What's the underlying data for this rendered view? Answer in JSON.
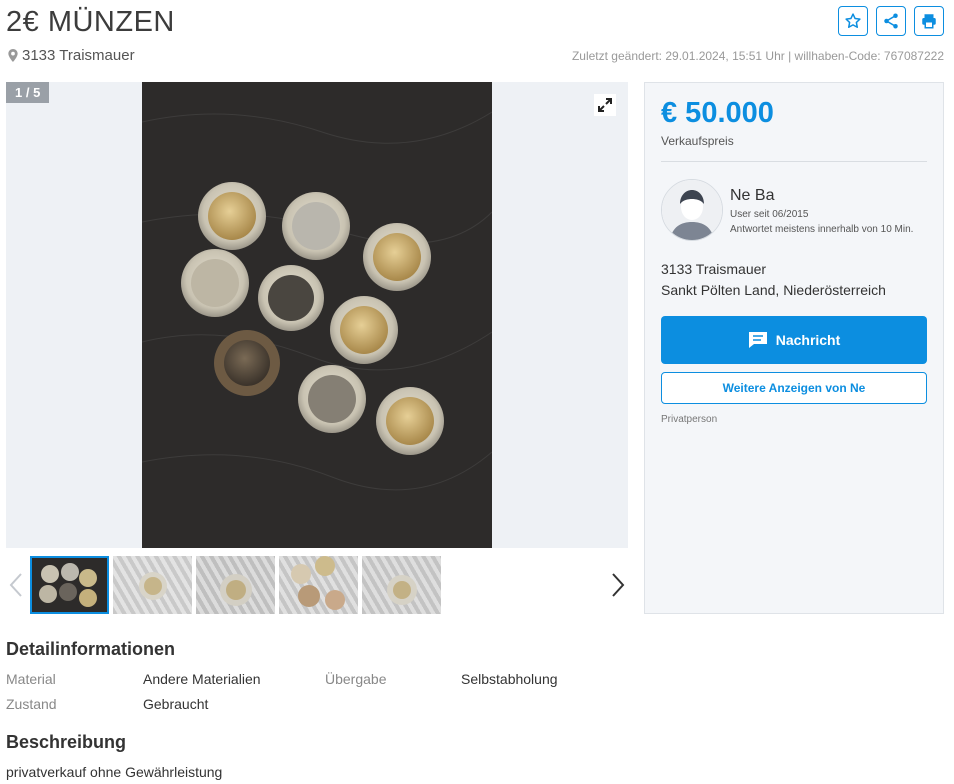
{
  "ad": {
    "title": "2€ MÜNZEN",
    "location": "3133 Traismauer",
    "meta": "Zuletzt geändert: 29.01.2024, 15:51 Uhr | willhaben-Code: 767087222"
  },
  "actions": {
    "favorite_icon": "star-icon",
    "share_icon": "share-icon",
    "print_icon": "print-icon"
  },
  "gallery": {
    "counter": "1 / 5",
    "thumbnails": [
      "thumb-1",
      "thumb-2",
      "thumb-3",
      "thumb-4",
      "thumb-5"
    ]
  },
  "sidebar": {
    "price": "€ 50.000",
    "price_label": "Verkaufspreis",
    "seller_name": "Ne Ba",
    "seller_since": "User seit 06/2015",
    "seller_response": "Antwortet meistens innerhalb von 10 Min.",
    "address_line1": "3133 Traismauer",
    "address_line2": "Sankt Pölten Land, Niederösterreich",
    "message_button": "Nachricht",
    "more_ads_button": "Weitere Anzeigen von Ne",
    "seller_type": "Privatperson"
  },
  "details": {
    "heading": "Detailinformationen",
    "rows": [
      {
        "label": "Material",
        "value": "Andere Materialien"
      },
      {
        "label": "Zustand",
        "value": "Gebraucht"
      },
      {
        "label": "Übergabe",
        "value": "Selbstabholung"
      }
    ]
  },
  "description": {
    "heading": "Beschreibung",
    "text": "privatverkauf ohne Gewährleistung"
  },
  "colors": {
    "accent": "#0c8ee0",
    "panel_bg": "#f4f6f9"
  }
}
